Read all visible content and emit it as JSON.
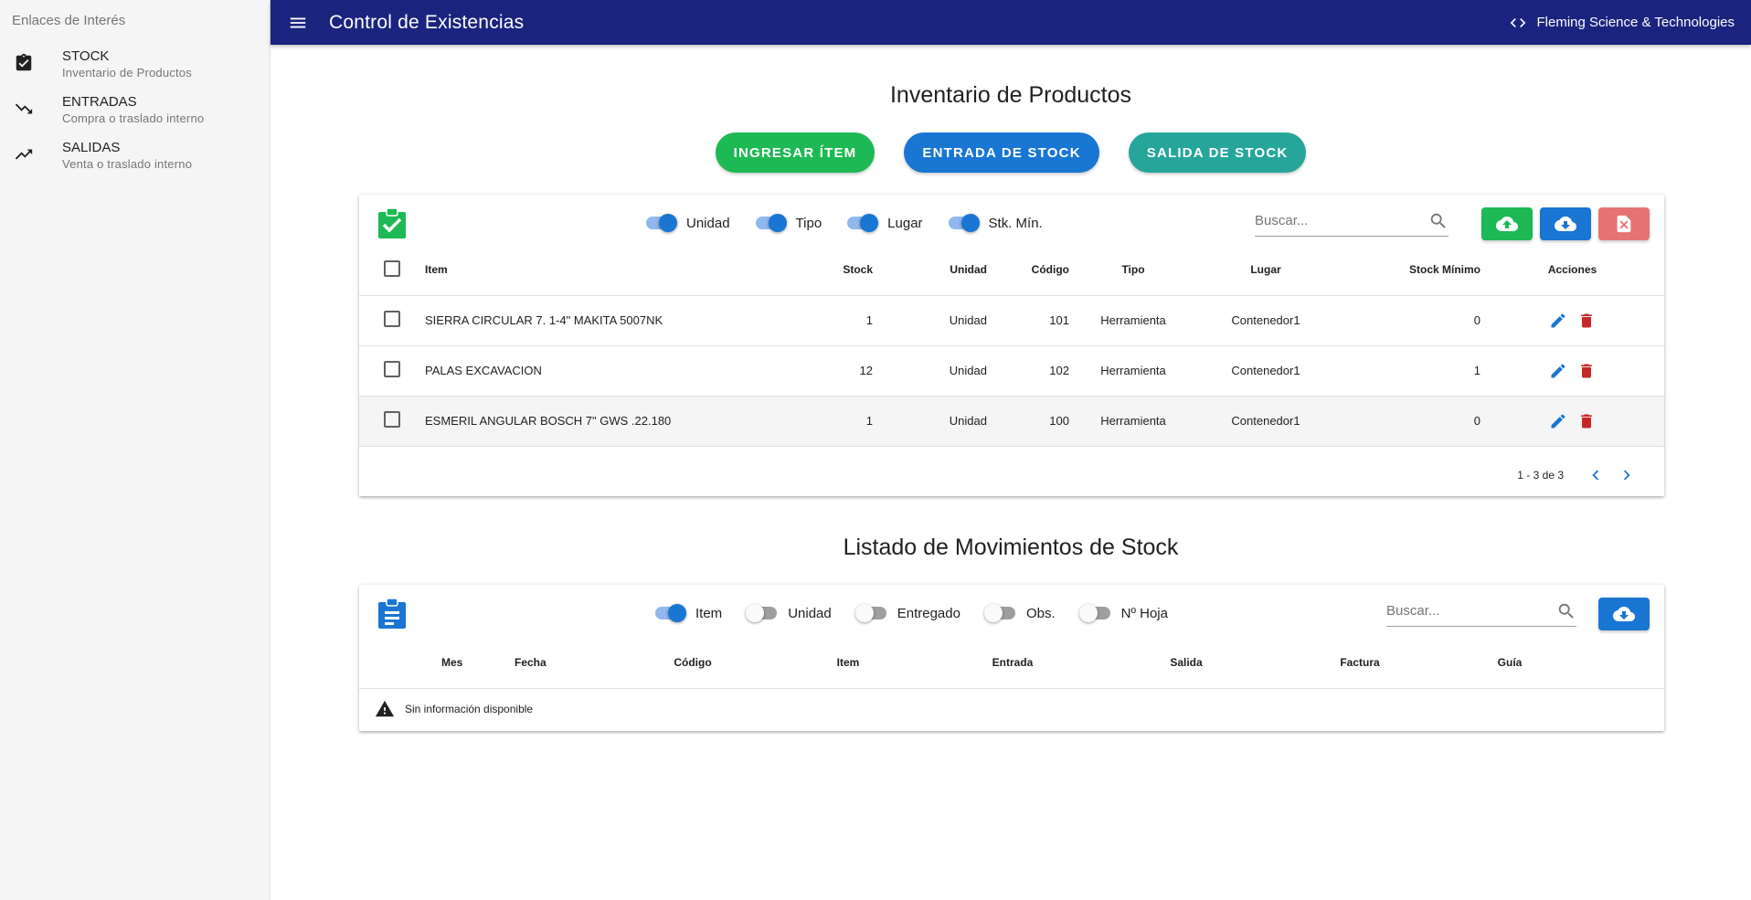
{
  "sidebar": {
    "title": "Enlaces de Interés",
    "items": [
      {
        "label": "STOCK",
        "sublabel": "Inventario de Productos",
        "icon": "clipboard-check-icon"
      },
      {
        "label": "ENTRADAS",
        "sublabel": "Compra o traslado interno",
        "icon": "trending-down-icon"
      },
      {
        "label": "SALIDAS",
        "sublabel": "Venta o traslado interno",
        "icon": "trending-up-icon"
      }
    ]
  },
  "appbar": {
    "title": "Control de Existencias",
    "company": "Fleming Science & Technologies",
    "color": "#1a237e"
  },
  "inventory": {
    "title": "Inventario de Productos",
    "buttons": {
      "add_item": "INGRESAR ÍTEM",
      "stock_in": "ENTRADA DE STOCK",
      "stock_out": "SALIDA DE STOCK"
    },
    "toggles": [
      {
        "label": "Unidad",
        "on": true
      },
      {
        "label": "Tipo",
        "on": true
      },
      {
        "label": "Lugar",
        "on": true
      },
      {
        "label": "Stk. Mín.",
        "on": true
      }
    ],
    "search_placeholder": "Buscar...",
    "columns": [
      "Item",
      "Stock",
      "Unidad",
      "Código",
      "Tipo",
      "Lugar",
      "Stock Mínimo",
      "Acciones"
    ],
    "rows": [
      {
        "item": "SIERRA CIRCULAR 7. 1-4\" MAKITA 5007NK",
        "stock": "1",
        "unidad": "Unidad",
        "codigo": "101",
        "tipo": "Herramienta",
        "lugar": "Contenedor1",
        "stock_min": "0"
      },
      {
        "item": "PALAS EXCAVACION",
        "stock": "12",
        "unidad": "Unidad",
        "codigo": "102",
        "tipo": "Herramienta",
        "lugar": "Contenedor1",
        "stock_min": "1"
      },
      {
        "item": "ESMERIL ANGULAR BOSCH 7\" GWS .22.180",
        "stock": "1",
        "unidad": "Unidad",
        "codigo": "100",
        "tipo": "Herramienta",
        "lugar": "Contenedor1",
        "stock_min": "0"
      }
    ],
    "pagination": "1 - 3 de 3"
  },
  "movements": {
    "title": "Listado de Movimientos de Stock",
    "toggles": [
      {
        "label": "Item",
        "on": true
      },
      {
        "label": "Unidad",
        "on": false
      },
      {
        "label": "Entregado",
        "on": false
      },
      {
        "label": "Obs.",
        "on": false
      },
      {
        "label": "Nº Hoja",
        "on": false
      }
    ],
    "search_placeholder": "Buscar...",
    "columns": [
      "Mes",
      "Fecha",
      "Código",
      "Item",
      "Entrada",
      "Salida",
      "Factura",
      "Guía"
    ],
    "empty_message": "Sin información disponible"
  },
  "colors": {
    "green": "#1db954",
    "blue": "#1976d2",
    "teal": "#26a69a",
    "red_light": "#e57373",
    "delete_red": "#c62828"
  }
}
